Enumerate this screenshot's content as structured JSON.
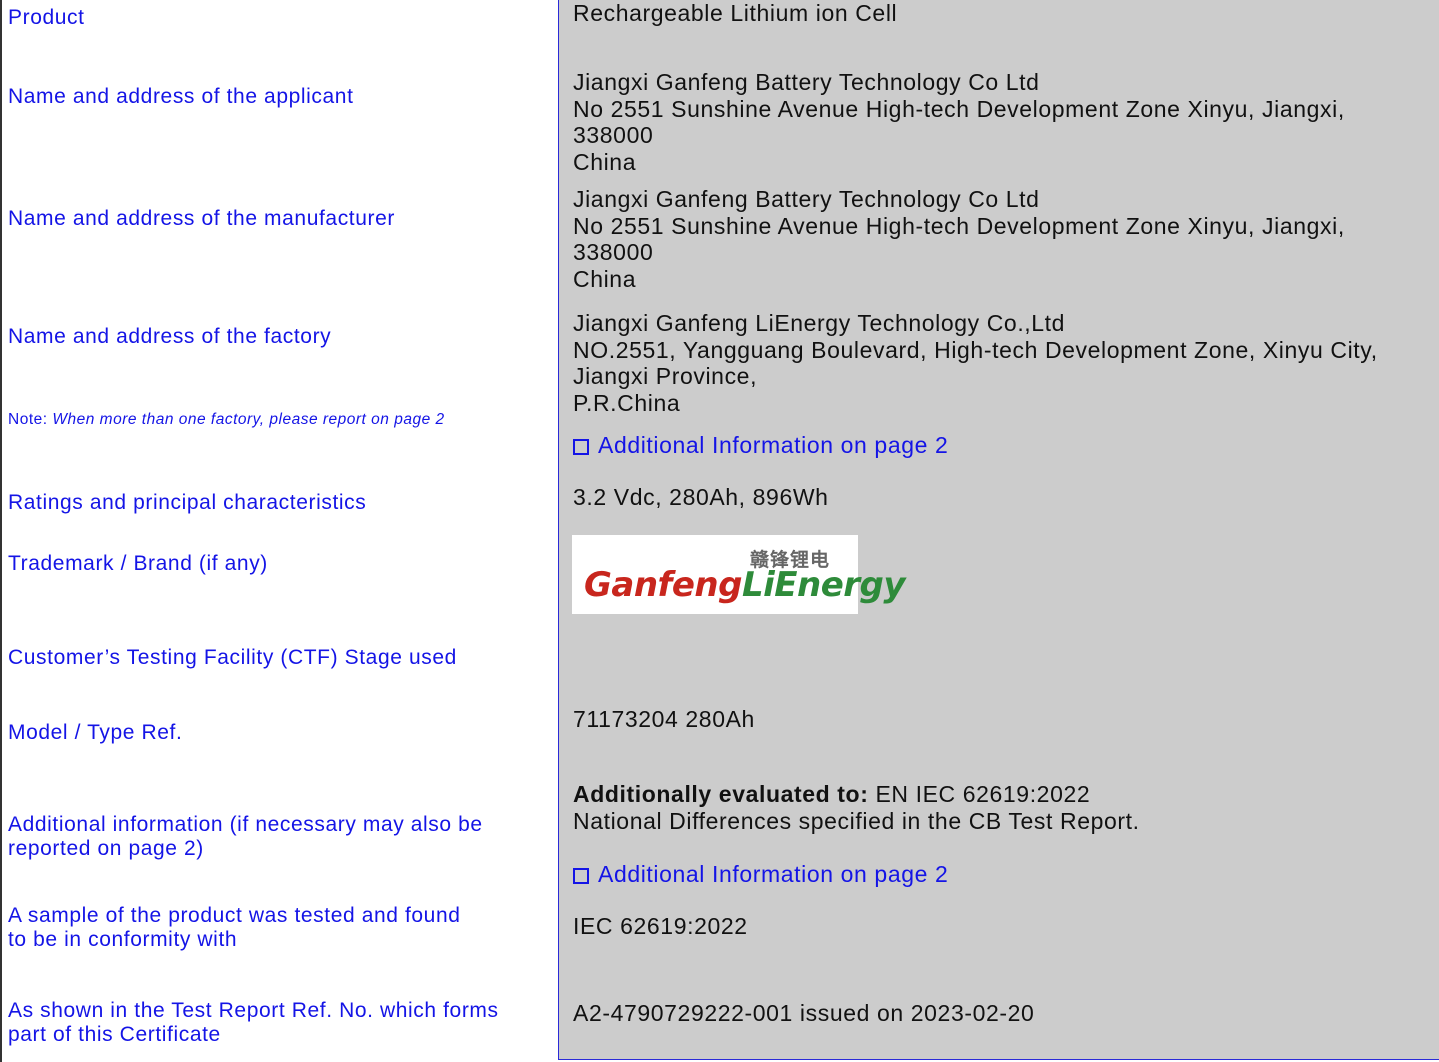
{
  "labels": {
    "product": "Product",
    "applicant": "Name and address of the applicant",
    "manufacturer": "Name and address of the manufacturer",
    "factory": "Name and address of the factory",
    "note_prefix": "Note: ",
    "note_text": "When more than one factory, please report on page 2",
    "ratings": "Ratings and principal characteristics",
    "trademark": "Trademark / Brand (if any)",
    "ctf": "Customer’s Testing Facility (CTF) Stage used",
    "model": "Model / Type Ref.",
    "additional_info_1": "Additional information (if necessary may also be",
    "additional_info_2": "reported on page 2)",
    "sample_1": "A sample of the product was tested and found",
    "sample_2": "to be in conformity with",
    "report_1": "As shown in the Test Report Ref. No. which forms",
    "report_2": "part of this Certificate"
  },
  "values": {
    "product": "Rechargeable Lithium ion Cell",
    "applicant": {
      "line1": "Jiangxi Ganfeng Battery Technology Co Ltd",
      "line2": "No 2551 Sunshine Avenue High-tech Development Zone Xinyu, Jiangxi,",
      "line3": "338000",
      "line4": "China"
    },
    "manufacturer": {
      "line1": "Jiangxi Ganfeng Battery Technology Co Ltd",
      "line2": "No 2551 Sunshine Avenue High-tech Development Zone Xinyu, Jiangxi,",
      "line3": "338000",
      "line4": "China"
    },
    "factory": {
      "line1": "Jiangxi Ganfeng LiEnergy Technology Co.,Ltd",
      "line2": "NO.2551, Yangguang Boulevard, High-tech Development Zone, Xinyu City,",
      "line3": "Jiangxi Province,",
      "line4": "P.R.China"
    },
    "factory_additional": "Additional Information on page 2",
    "ratings": "3.2 Vdc, 280Ah, 896Wh",
    "logo": {
      "chinese": "赣锋锂电",
      "part1": "Ganfeng",
      "part2": "LiEnergy"
    },
    "model": "71173204 280Ah",
    "additional_bold": "Additionally evaluated to:",
    "additional_rest": " EN IEC 62619:2022",
    "additional_line2": "National Differences specified in the CB Test Report.",
    "additional_checkbox": "Additional Information on page 2",
    "conformity": "IEC 62619:2022",
    "report": "A2-4790729222-001 issued on 2023-02-20"
  }
}
